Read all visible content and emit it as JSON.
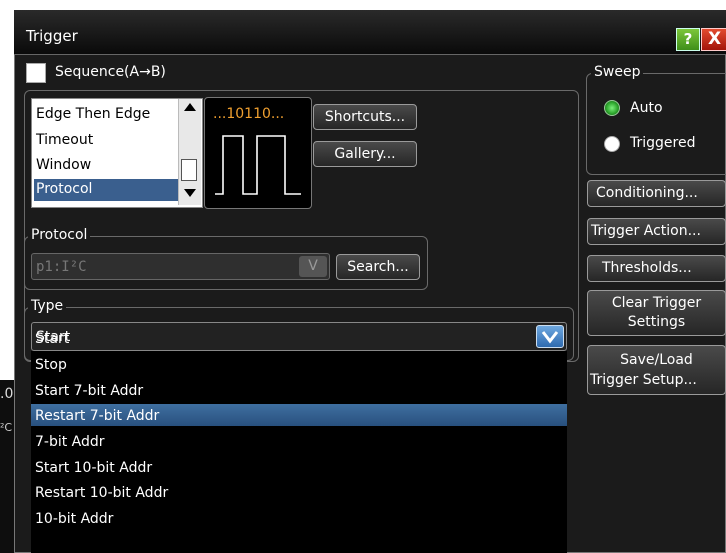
{
  "dialog": {
    "title": "Trigger",
    "help_label": "?",
    "close_label": "X"
  },
  "sequence": {
    "label": "Sequence(A→B)",
    "checked": false
  },
  "trigger_types": {
    "items": [
      "Edge Then Edge",
      "Timeout",
      "Window",
      "Protocol"
    ],
    "selected": "Protocol"
  },
  "preview": {
    "text": "...10110..."
  },
  "buttons": {
    "shortcuts": "Shortcuts...",
    "gallery": "Gallery...",
    "search": "Search..."
  },
  "protocol": {
    "group_label": "Protocol",
    "value": "p1:I²C"
  },
  "type": {
    "group_label": "Type",
    "value": "Start",
    "options": [
      "Start",
      "Stop",
      "Start 7-bit Addr",
      "Restart 7-bit Addr",
      "7-bit Addr",
      "Start 10-bit Addr",
      "Restart 10-bit Addr",
      "10-bit Addr"
    ],
    "highlighted": "Start 7-bit Addr"
  },
  "sweep": {
    "group_label": "Sweep",
    "options": [
      "Auto",
      "Triggered"
    ],
    "selected": "Auto"
  },
  "side_buttons": {
    "conditioning": "Conditioning...",
    "trigger_action": "Trigger Action...",
    "thresholds": "Thresholds...",
    "clear_line1": "Clear Trigger",
    "clear_line2": "Settings",
    "save_line1": "Save/Load",
    "save_line2": "Trigger Setup..."
  },
  "background": {
    "fragment_1": ".0",
    "fragment_2": "²C"
  },
  "colors": {
    "dialog_bg": "#1b1b1b",
    "selection_blue": "#3a5f8e",
    "preview_orange": "#f0a030",
    "radio_green": "#3ec03e"
  }
}
